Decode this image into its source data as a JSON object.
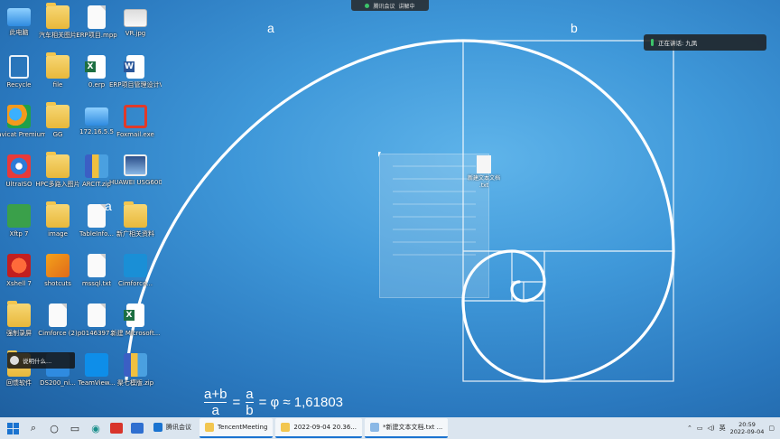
{
  "wallpaper": {
    "label_a": "a",
    "label_b": "b",
    "label_a_small": "a",
    "formula": {
      "left_num": "a+b",
      "left_den": "a",
      "mid_num": "a",
      "mid_den": "b",
      "equals": "=",
      "tail": "= φ ≈ 1,61803"
    }
  },
  "meeting_bar": {
    "left": "腾讯会议",
    "right": "讲解中"
  },
  "speaker": {
    "text": "正在讲话: 九凤"
  },
  "side_pop": {
    "text": "说明什么..."
  },
  "context_file": {
    "label": "新建文本文档 .txt"
  },
  "desktop_icons": [
    {
      "label": "此电脑",
      "icon": "pc-icon"
    },
    {
      "label": "汽车相关图片",
      "icon": "folder-icon"
    },
    {
      "label": "ERP项目.mpp",
      "icon": "doc-icon"
    },
    {
      "label": "VR.jpg",
      "icon": "image-icon"
    },
    {
      "label": "Recycle",
      "icon": "recycle-icon"
    },
    {
      "label": "file",
      "icon": "folder-icon"
    },
    {
      "label": "0.erp",
      "icon": "excel-icon"
    },
    {
      "label": "ERP项目管理设计V1.0...",
      "icon": "word-icon"
    },
    {
      "label": "Navicat Premium 12",
      "icon": "navicat-icon"
    },
    {
      "label": "GG",
      "icon": "folder-icon"
    },
    {
      "label": "172.16.5.5",
      "icon": "pc-icon"
    },
    {
      "label": "Foxmail.exe",
      "icon": "foxmail-icon"
    },
    {
      "label": "UltraISO",
      "icon": "ultraiso-icon"
    },
    {
      "label": "HPC多路入图片",
      "icon": "folder-icon"
    },
    {
      "label": "ARCIT.zip",
      "icon": "archive-icon"
    },
    {
      "label": "HUAWEI USG6000...",
      "icon": "image-icon"
    },
    {
      "label": "Xftp 7",
      "icon": "xftp-icon"
    },
    {
      "label": "image",
      "icon": "folder-icon"
    },
    {
      "label": "TableInfo...",
      "icon": "doc-icon"
    },
    {
      "label": "新广相关资料",
      "icon": "folder-icon"
    },
    {
      "label": "Xshell 7",
      "icon": "xshell-icon"
    },
    {
      "label": "shotcuts",
      "icon": "tool-icon"
    },
    {
      "label": "mssql.txt",
      "icon": "doc-icon"
    },
    {
      "label": "Cimforce...",
      "icon": "cimforce-icon"
    },
    {
      "label": "强制录屏",
      "icon": "folder-icon"
    },
    {
      "label": "Cimforce (2)",
      "icon": "doc-icon"
    },
    {
      "label": "p0146397...",
      "icon": "doc-icon"
    },
    {
      "label": "新建 Microsoft...",
      "icon": "excel-icon"
    },
    {
      "label": "回馈软件",
      "icon": "folder-icon"
    },
    {
      "label": "DS200_ni...",
      "icon": "blue-icon"
    },
    {
      "label": "TeamView...",
      "icon": "teamviewer-icon"
    },
    {
      "label": "渠七模版.zip",
      "icon": "archive-icon"
    }
  ],
  "taskbar": {
    "apps": [
      {
        "label": "腾讯会议",
        "color": "#1a73d0"
      },
      {
        "label": "TencentMeeting",
        "color": "#f2c650"
      },
      {
        "label": "2022-09-04 20.36...",
        "color": "#f2c650"
      },
      {
        "label": "*新建文本文档.txt ...",
        "color": "#8ab8e6"
      }
    ],
    "ime": "英",
    "time": "20:59",
    "date": "2022-09-04"
  },
  "colors": {
    "wallpaper_center": "#5fb4ea",
    "wallpaper_edge": "#1e5f9f",
    "taskbar": "#dbe5ef"
  }
}
